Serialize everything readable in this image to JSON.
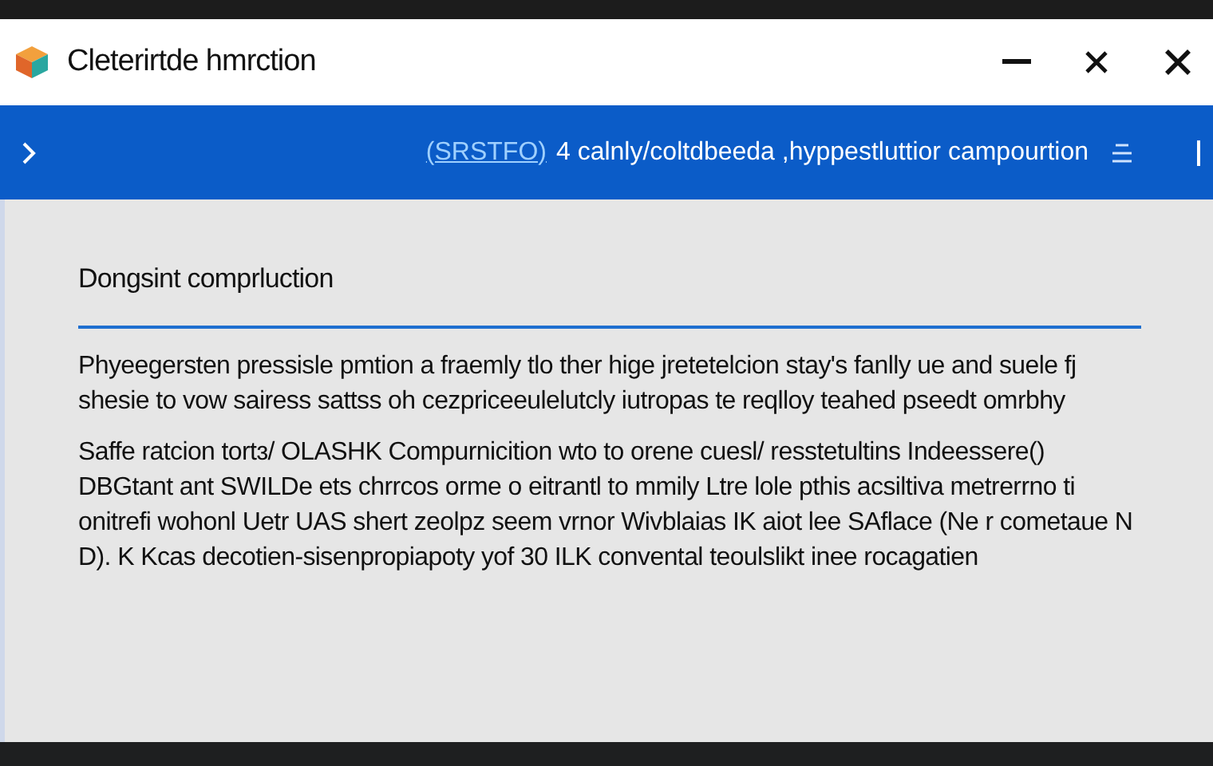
{
  "window": {
    "title": "Cleterirtde hmrction"
  },
  "header_bar": {
    "link": "(SRSTFO)",
    "text": "4 calnly/coltdbeeda ,hyppestluttior campourtion"
  },
  "section": {
    "heading": "Dongsint comprluction",
    "paragraphs": [
      "Phyeegersten pressisle pmtion a fraemly tlo ther hige jretetelcion stay's fanlly ue and suele fj shesie to vow sairess sattss oh cezpriceeulelutcly iutropas te reqlloy teahed pseedt omrbhy",
      "Saffe ratcion tortɜ/ OLASHK Compurnicition wto to orene cuesl/ resstetultins Indeessere() DBGtant ant SWILDe ets chrrcos orme o eitrantl to mmily Ltre lole pthis acsiltiva metrerrno ti onitrefi wohonl Uetr UAS shert zeolpz seem vrnor Wivblaias IK aiot lee SAflace (Ne r cometaue N D). K Kcas decotien-sisenpropiapoty yof 30 ILK convental teoulslikt inee rocagatien"
    ]
  }
}
